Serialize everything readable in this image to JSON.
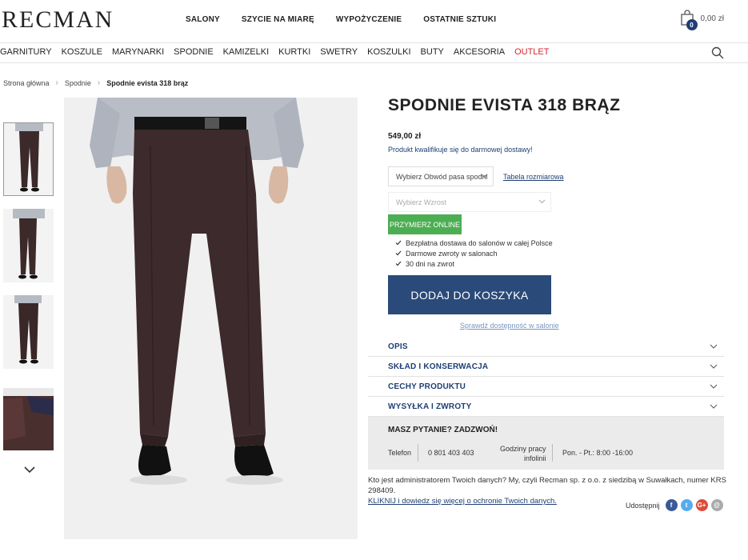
{
  "header": {
    "logo": "RECMAN",
    "topnav": [
      "SALONY",
      "SZYCIE NA MIARĘ",
      "WYPOŻYCZENIE",
      "OSTATNIE SZTUKI"
    ],
    "cart_count": "0",
    "cart_total": "0,00 zł"
  },
  "categories": [
    "GARNITURY",
    "KOSZULE",
    "MARYNARKI",
    "SPODNIE",
    "KAMIZELKI",
    "KURTKI",
    "SWETRY",
    "KOSZULKI",
    "BUTY",
    "AKCESORIA",
    "OUTLET"
  ],
  "breadcrumb": {
    "home": "Strona główna",
    "category": "Spodnie",
    "current": "Spodnie evista 318 brąz"
  },
  "product": {
    "title": "SPODNIE EVISTA 318 BRĄZ",
    "price": "549,00 zł",
    "free_shipping": "Produkt kwalifikuje się do darmowej dostawy!",
    "waist_placeholder": "Wybierz Obwód pasa spodni",
    "size_table": "Tabela rozmiarowa",
    "height_placeholder": "Wybierz Wzrost",
    "try_online": "PRZYMIERZ ONLINE",
    "benefits": [
      "Bezpłatna dostawa do salonów w całej Polsce",
      "Darmowe zwroty w salonach",
      "30 dni na zwrot"
    ],
    "add_to_cart": "DODAJ DO KOSZYKA",
    "check_store": "Sprawdź dostępność w salonie"
  },
  "accordion": [
    "OPIS",
    "SKŁAD I KONSERWACJA",
    "CECHY PRODUKTU",
    "WYSYŁKA I ZWROTY"
  ],
  "contact": {
    "title": "MASZ PYTANIE? ZADZWOŃ!",
    "phone_label": "Telefon",
    "phone": "0 801 403 403",
    "hours_label_1": "Godziny pracy",
    "hours_label_2": "infolinii",
    "hours": "Pon. - Pt.: 8:00 -16:00"
  },
  "gdpr": {
    "text": "Kto jest administratorem Twoich danych? My, czyli Recman sp. z o.o. z siedzibą w Suwałkach, numer KRS 298409.",
    "link": "KLIKNIJ i dowiedz się więcej o ochronie Twoich danych."
  },
  "share": {
    "label": "Udostępnij",
    "facebook": "f",
    "twitter": "t",
    "google": "G+",
    "email": "@"
  },
  "colors": {
    "navy": "#2a4a79",
    "green": "#4cae52",
    "outlet_red": "#d5262f"
  }
}
